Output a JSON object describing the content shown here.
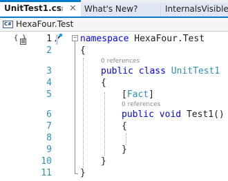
{
  "tabs": [
    {
      "label": "UnitTest1.cs",
      "active": true,
      "pin_icon": "pin-icon",
      "close_icon": "close-icon"
    },
    {
      "label": "What's New?",
      "active": false
    },
    {
      "label": "InternalsVisibleTo",
      "active": false
    }
  ],
  "navbar": {
    "badge": "C#",
    "scope": "HexaFour.Test"
  },
  "editor": {
    "references_label": "0 references",
    "lines": [
      {
        "num": "1",
        "text": ""
      },
      {
        "num": "2",
        "text": "{"
      },
      {
        "num": "3",
        "text": ""
      },
      {
        "num": "4",
        "text": "{"
      },
      {
        "num": "5",
        "text": ""
      },
      {
        "num": "6",
        "text": ""
      },
      {
        "num": "7",
        "text": "{"
      },
      {
        "num": "8",
        "text": ""
      },
      {
        "num": "9",
        "text": "}"
      },
      {
        "num": "10",
        "text": "}"
      },
      {
        "num": "11",
        "text": "}"
      }
    ],
    "tokens": {
      "namespace_kw": "namespace",
      "namespace_name": " HexaFour.Test",
      "public_kw": "public",
      "class_kw": " class ",
      "class_name": "UnitTest1",
      "attr_open": "[",
      "attr_name": "Fact",
      "attr_close": "]",
      "void_kw": " void ",
      "method_sig": "Test1()"
    }
  },
  "colors": {
    "accent": "#007acc",
    "keyword": "#0000ff",
    "type": "#2b91af",
    "line_number": "#2b91af"
  }
}
